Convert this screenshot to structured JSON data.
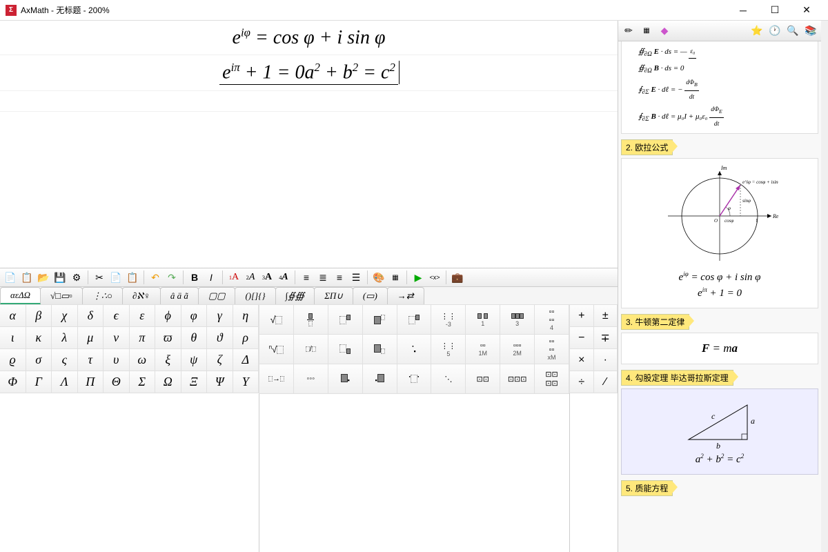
{
  "title": "AxMath - 无标题 - 200%",
  "equations": {
    "line1": "e<sup>iφ</sup> = cos φ + i sin φ",
    "line2": "e<sup>iπ</sup> + 1 = 0a<sup>2</sup> + b<sup>2</sup> = c<sup>2</sup>"
  },
  "tabs": [
    "αεΔΩ",
    "√□▭▫",
    "⋮∴○",
    "∂ℵ♀",
    "â ä ã",
    "▢▢",
    "()[]{}",
    "∫∯∰",
    "ΣΠ∪",
    "(▭)",
    "→⇄"
  ],
  "greek": [
    "α",
    "β",
    "χ",
    "δ",
    "ϵ",
    "ε",
    "ϕ",
    "φ",
    "γ",
    "η",
    "ι",
    "κ",
    "λ",
    "μ",
    "ν",
    "π",
    "ϖ",
    "θ",
    "ϑ",
    "ρ",
    "ϱ",
    "σ",
    "ς",
    "τ",
    "υ",
    "ω",
    "ξ",
    "ψ",
    "ζ",
    "Δ",
    "Φ",
    "Γ",
    "Λ",
    "Π",
    "Θ",
    "Σ",
    "Ω",
    "Ξ",
    "Ψ",
    "Υ"
  ],
  "ops": [
    "+",
    "±",
    "−",
    "∓",
    "×",
    "·",
    "÷",
    "∕"
  ],
  "struct_labels": [
    "-3",
    "1",
    "3",
    "4",
    "5",
    "1M",
    "2M",
    "xM"
  ],
  "sections": {
    "s2": "2. 欧拉公式",
    "s2_eq1": "e<sup>iφ</sup> = cos φ + i sin φ",
    "s2_eq2": "e<sup>iπ</sup> + 1 = 0",
    "s3": "3. 牛顿第二定律",
    "s3_eq": "F = ma",
    "s4": "4. 勾股定理 毕达哥拉斯定理",
    "s4_eq": "a<sup>2</sup> + b<sup>2</sup> = c<sup>2</sup>",
    "s5": "5. 质能方程",
    "triangle": {
      "a": "a",
      "b": "b",
      "c": "c"
    },
    "circle": {
      "im": "Im",
      "re": "Re",
      "eq": "e<sup>iφ</sup> = cosφ + isinφ",
      "sin": "sinφ",
      "cos": "cosφ",
      "phi": "φ",
      "o": "O",
      "one": "1"
    }
  },
  "maxwell": {
    "l1": "∯<sub>∂Ω</sub> <b>E</b> · ds = —",
    "l2": "∯<sub>∂Ω</sub> <b>B</b> · ds = 0",
    "l3": "∮<sub>∂Σ</sub> <b>E</b> · dℓ = −",
    "l4": "∮<sub>∂Σ</sub> <b>B</b> · dℓ = μ₀I + μ₀ε₀"
  }
}
